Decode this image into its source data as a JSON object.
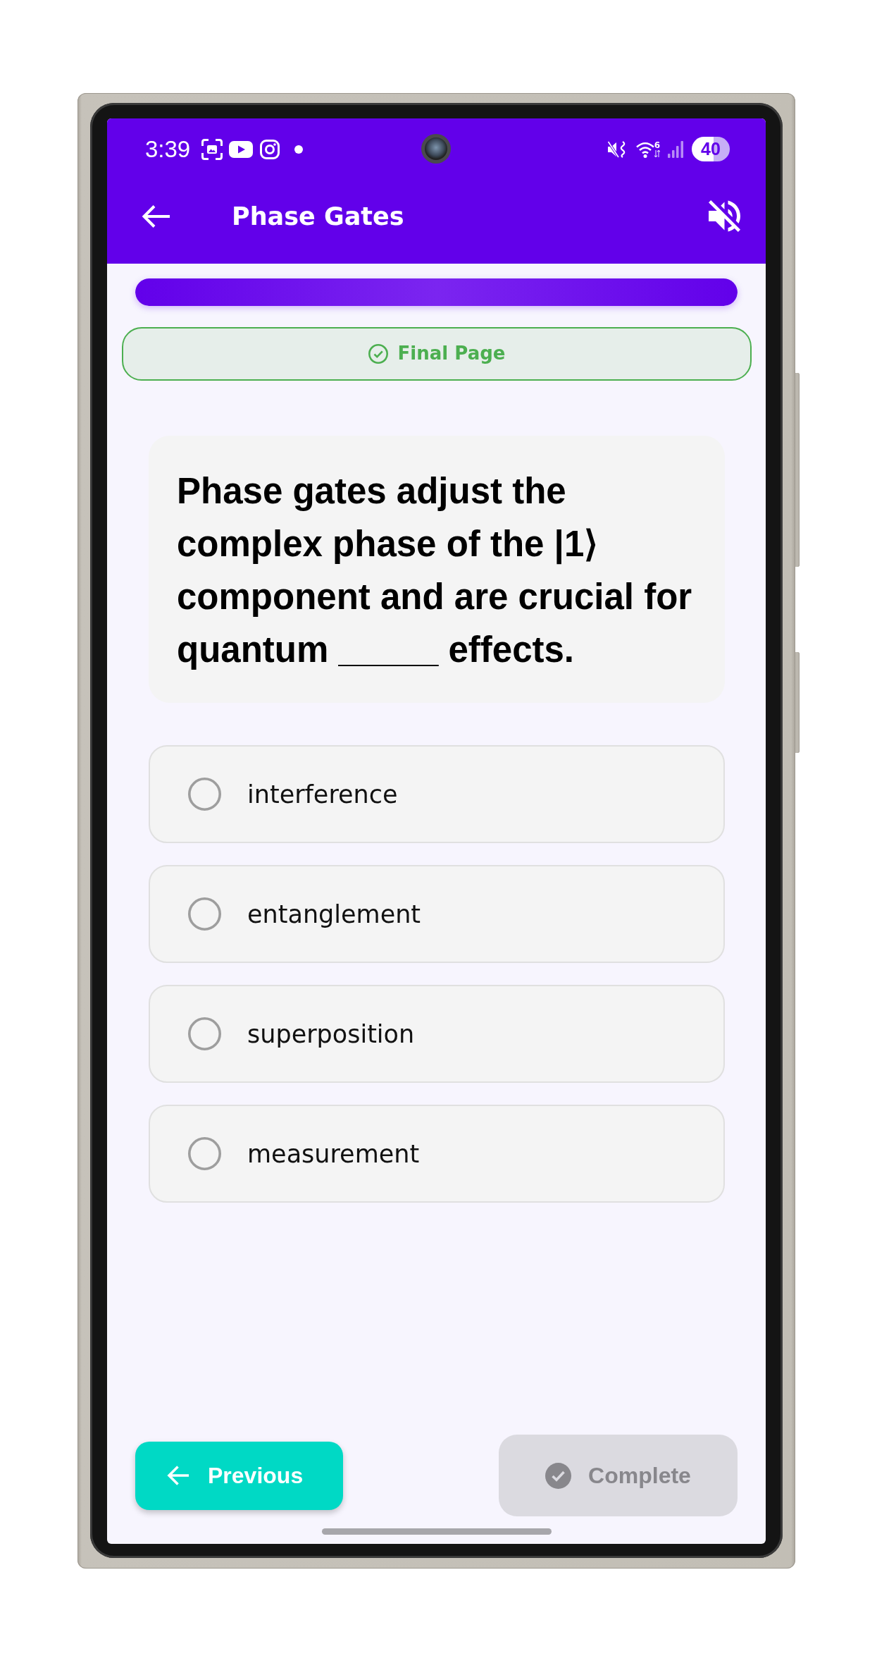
{
  "status_bar": {
    "time": "3:39",
    "wifi_standard": "6",
    "battery": "40"
  },
  "app_bar": {
    "title": "Phase Gates",
    "sound_muted": true
  },
  "progress": {
    "level": 1
  },
  "banner": {
    "label": "Final Page"
  },
  "question": {
    "text": "Phase gates adjust the complex phase of the |1⟩ component and are crucial for quantum _____ effects."
  },
  "options": [
    {
      "label": "interference",
      "selected": false
    },
    {
      "label": "entanglement",
      "selected": false
    },
    {
      "label": "superposition",
      "selected": false
    },
    {
      "label": "measurement",
      "selected": false
    }
  ],
  "buttons": [
    {
      "kind": "previous",
      "label": "Previous",
      "disabled": false
    },
    {
      "kind": "complete",
      "label": "Complete",
      "disabled": true
    }
  ]
}
